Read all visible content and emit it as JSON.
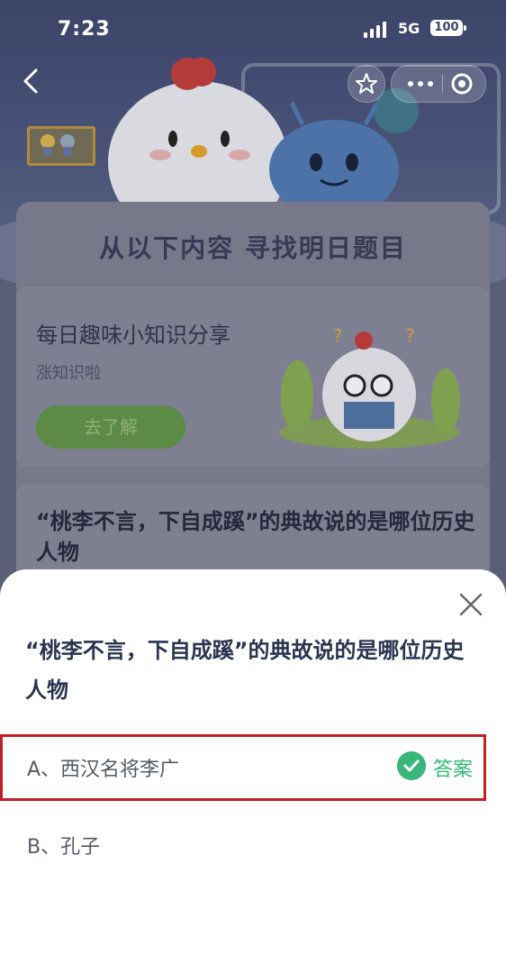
{
  "status_bar": {
    "time": "7:23",
    "network": "5G",
    "battery": "100"
  },
  "background": {
    "section_title": "从以下内容  寻找明日题目",
    "tip_card": {
      "title": "每日趣味小知识分享",
      "subtitle": "涨知识啦",
      "button_label": "去了解"
    },
    "question_preview": "“桃李不言，下自成蹊”的典故说的是哪位历史人物"
  },
  "sheet": {
    "question": "“桃李不言，下自成蹊”的典故说的是哪位历史人物",
    "options": [
      {
        "label": "A、西汉名将李广",
        "is_answer": true,
        "answer_badge": "答案"
      },
      {
        "label": "B、孔子",
        "is_answer": false
      }
    ]
  },
  "colors": {
    "answer_green": "#39b77a",
    "highlight_red": "#c21f25",
    "question_text": "#2b3550"
  },
  "icons": {
    "back": "chevron-left-icon",
    "favorite": "star-icon",
    "more": "more-dots-icon",
    "mini_close": "record-circle-icon",
    "sheet_close": "close-icon",
    "answer": "check-circle-icon"
  }
}
